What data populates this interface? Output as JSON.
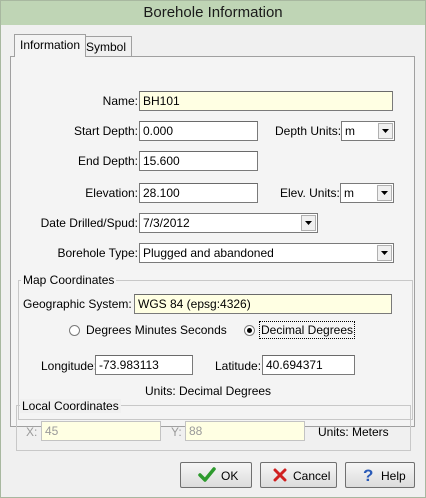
{
  "window": {
    "title": "Borehole Information"
  },
  "tabs": [
    {
      "label": "Information",
      "active": true
    },
    {
      "label": "Symbol",
      "active": false
    }
  ],
  "info": {
    "name_label": "Name:",
    "name_value": "BH101",
    "start_depth_label": "Start Depth:",
    "start_depth_value": "0.000",
    "depth_units_label": "Depth Units:",
    "depth_units_value": "m",
    "end_depth_label": "End Depth:",
    "end_depth_value": "15.600",
    "elevation_label": "Elevation:",
    "elevation_value": "28.100",
    "elev_units_label": "Elev. Units:",
    "elev_units_value": "m",
    "date_label": "Date Drilled/Spud:",
    "date_value": "7/3/2012",
    "type_label": "Borehole Type:",
    "type_value": "Plugged and abandoned"
  },
  "map": {
    "group_title": "Map Coordinates",
    "geo_system_label": "Geographic System:",
    "geo_system_value": "WGS 84 (epsg:4326)",
    "radio_dms_label": "Degrees Minutes Seconds",
    "radio_dd_label": "Decimal Degrees",
    "selected": "Decimal Degrees",
    "longitude_label": "Longitude:",
    "longitude_value": "-73.983113",
    "latitude_label": "Latitude:",
    "latitude_value": "40.694371",
    "units_text": "Units: Decimal Degrees"
  },
  "local": {
    "group_title": "Local Coordinates",
    "x_label": "X:",
    "x_value": "45",
    "y_label": "Y:",
    "y_value": "88",
    "units_text": "Units: Meters"
  },
  "buttons": {
    "ok": "OK",
    "cancel": "Cancel",
    "help": "Help"
  },
  "colors": {
    "titlebar": "#bfd5b5",
    "required_field": "#ffffe3",
    "ok_icon": "#2e9a2e",
    "cancel_icon": "#d02020",
    "help_icon": "#2a5bb8"
  }
}
